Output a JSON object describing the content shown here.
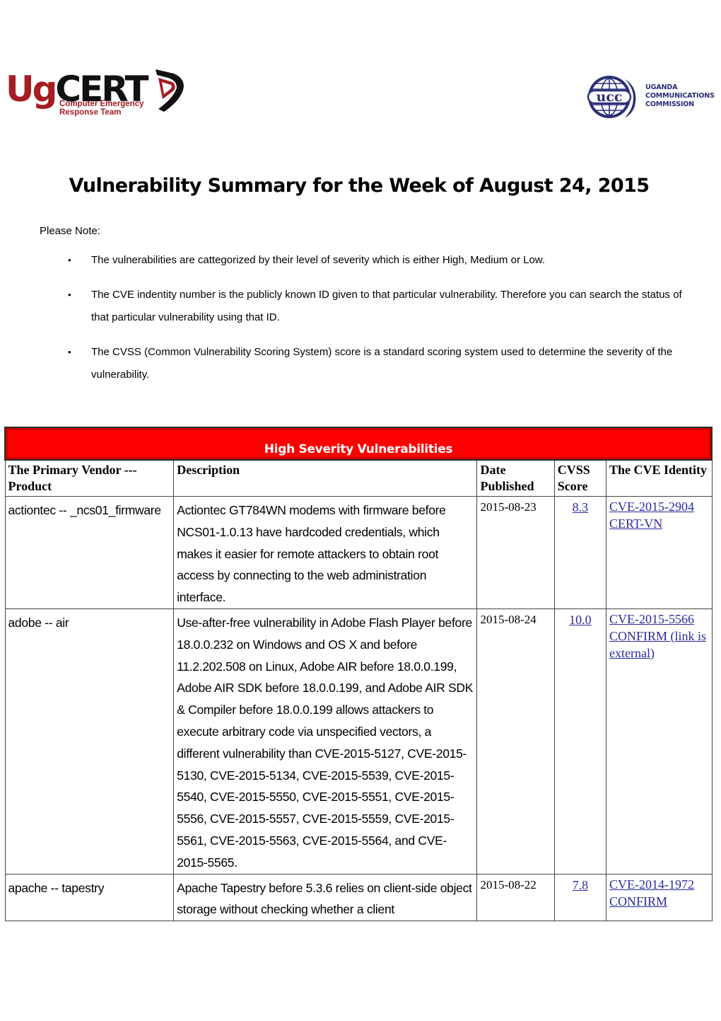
{
  "header": {
    "left_logo": {
      "name_part1": "Ug",
      "name_part2": "CERT",
      "subtitle_line1": "Computer Emergency",
      "subtitle_line2": "Response Team",
      "colors": {
        "red": "#a51e22",
        "black": "#111111"
      }
    },
    "right_logo": {
      "emblem_text": "ucc",
      "line1": "UGANDA",
      "line2": "COMMUNICATIONS",
      "line3": "COMMISSION",
      "color": "#2a2f78"
    }
  },
  "title": "Vulnerability Summary for the Week of August 24, 2015",
  "notes": {
    "label": "Please Note:",
    "bullet": "•",
    "items": [
      "The vulnerabilities are cattegorized by their level of severity which is either High, Medium or Low.",
      "The CVE indentity number is the publicly known ID given to that particular vulnerability. Therefore you can search the status of that particular vulnerability using that ID.",
      "The CVSS (Common Vulnerability Scoring System) score is a standard  scoring system used to determine the severity of the vulnerability."
    ]
  },
  "table": {
    "section_title": "High Severity Vulnerabilities",
    "section_color": "#ff0000",
    "columns": [
      "The Primary Vendor --- Product",
      "Description",
      "Date Published",
      "CVSS Score",
      "The CVE Identity"
    ],
    "rows": [
      {
        "vendor": "actiontec -- _ncs01_firmware",
        "description": "Actiontec GT784WN modems with firmware before NCS01-1.0.13 have hardcoded credentials, which makes it easier for remote attackers to obtain root access by connecting to the web administration interface.",
        "date": "2015-08-23",
        "score": "8.3",
        "cve_links": [
          "CVE-2015-2904",
          "CERT-VN"
        ]
      },
      {
        "vendor": "adobe -- air",
        "description": "Use-after-free vulnerability in Adobe Flash Player before 18.0.0.232 on Windows and OS X and before 11.2.202.508 on Linux, Adobe AIR before 18.0.0.199, Adobe AIR SDK before 18.0.0.199, and Adobe AIR SDK & Compiler before 18.0.0.199 allows attackers to execute arbitrary code via unspecified vectors, a different vulnerability than CVE-2015-5127, CVE-2015-5130, CVE-2015-5134, CVE-2015-5539, CVE-2015-5540, CVE-2015-5550, CVE-2015-5551, CVE-2015-5556, CVE-2015-5557, CVE-2015-5559, CVE-2015-5561, CVE-2015-5563, CVE-2015-5564, and CVE-2015-5565.",
        "date": "2015-08-24",
        "score": "10.0",
        "cve_links": [
          "CVE-2015-5566",
          "CONFIRM (link is external)"
        ]
      },
      {
        "vendor": "apache -- tapestry",
        "description": "Apache Tapestry before 5.3.6 relies on client-side object storage without checking whether a client",
        "date": "2015-08-22",
        "score": "7.8",
        "cve_links": [
          "CVE-2014-1972",
          "CONFIRM"
        ]
      }
    ]
  }
}
